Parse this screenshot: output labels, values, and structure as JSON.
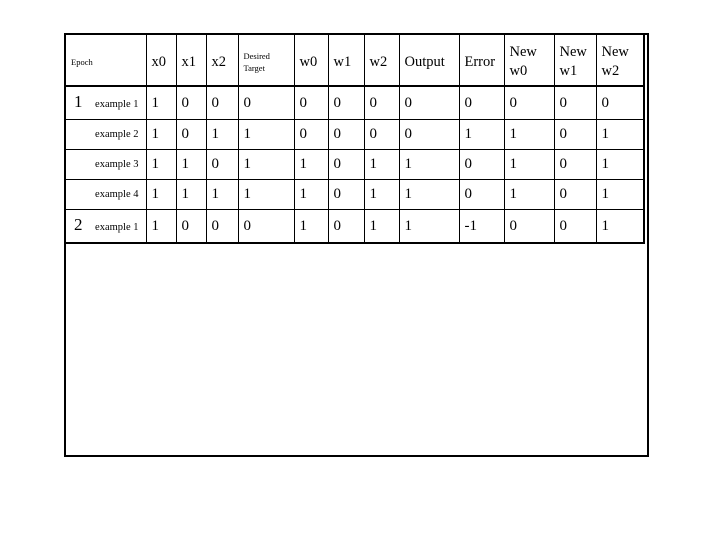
{
  "table": {
    "headers": [
      {
        "text": "Epoch",
        "style": "small",
        "col": "epoch"
      },
      {
        "text": "x0",
        "style": "big",
        "col": "x0"
      },
      {
        "text": "x1",
        "style": "big",
        "col": "x1"
      },
      {
        "text": "x2",
        "style": "big",
        "col": "x2"
      },
      {
        "text": "Desired Target",
        "line1": "Desired",
        "line2": "Target",
        "style": "small-two",
        "col": "target"
      },
      {
        "text": "w0",
        "style": "big",
        "col": "w0"
      },
      {
        "text": "w1",
        "style": "big",
        "col": "w1"
      },
      {
        "text": "w2",
        "style": "big",
        "col": "w2"
      },
      {
        "text": "Output",
        "style": "big",
        "col": "output"
      },
      {
        "text": "Error",
        "style": "big",
        "col": "error"
      },
      {
        "text": "New w0",
        "line1": "New",
        "line2": "w0",
        "style": "big-two",
        "col": "new0"
      },
      {
        "text": "New w1",
        "line1": "New",
        "line2": "w1",
        "style": "big-two",
        "col": "new1"
      },
      {
        "text": "New w2",
        "line1": "New",
        "line2": "w2",
        "style": "big-two",
        "col": "new2"
      }
    ],
    "rows": [
      {
        "epoch": "1",
        "example": "example 1",
        "x0": "1",
        "x1": "0",
        "x2": "0",
        "target": "0",
        "w0": "0",
        "w1": "0",
        "w2": "0",
        "output": "0",
        "error": "0",
        "new_w0": "0",
        "new_w1": "0",
        "new_w2": "0"
      },
      {
        "epoch": "",
        "example": "example 2",
        "x0": "1",
        "x1": "0",
        "x2": "1",
        "target": "1",
        "w0": "0",
        "w1": "0",
        "w2": "0",
        "output": "0",
        "error": "1",
        "new_w0": "1",
        "new_w1": "0",
        "new_w2": "1"
      },
      {
        "epoch": "",
        "example": "example 3",
        "x0": "1",
        "x1": "1",
        "x2": "0",
        "target": "1",
        "w0": "1",
        "w1": "0",
        "w2": "1",
        "output": "1",
        "error": "0",
        "new_w0": "1",
        "new_w1": "0",
        "new_w2": "1"
      },
      {
        "epoch": "",
        "example": "example 4",
        "x0": "1",
        "x1": "1",
        "x2": "1",
        "target": "1",
        "w0": "1",
        "w1": "0",
        "w2": "1",
        "output": "1",
        "error": "0",
        "new_w0": "1",
        "new_w1": "0",
        "new_w2": "1"
      },
      {
        "epoch": "2",
        "example": "example 1",
        "x0": "1",
        "x1": "0",
        "x2": "0",
        "target": "0",
        "w0": "1",
        "w1": "0",
        "w2": "1",
        "output": "1",
        "error": "-1",
        "new_w0": "0",
        "new_w1": "0",
        "new_w2": "1"
      }
    ]
  },
  "colors": {
    "border": "#000000",
    "background": "#ffffff",
    "text": "#000000"
  }
}
